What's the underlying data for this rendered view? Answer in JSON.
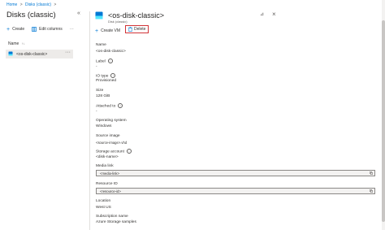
{
  "breadcrumb": {
    "items": [
      "Home",
      "Disks (classic)"
    ],
    "separator": ">"
  },
  "left_pane": {
    "title": "Disks (classic)",
    "collapse_glyph": "«",
    "toolbar": {
      "create": "Create",
      "edit_columns": "Edit columns",
      "more": "···"
    },
    "column_header": "Name",
    "sort_glyph": "↑↓",
    "items": [
      {
        "label": "<os-disk-classic>",
        "more": "···"
      }
    ]
  },
  "right_pane": {
    "title": "<os-disk-classic>",
    "subtitle": "Disk (classic)",
    "pin_glyph": "⊿",
    "close_glyph": "×",
    "toolbar": {
      "create_vm": "Create VM",
      "delete": "Delete"
    },
    "fields": {
      "name": {
        "label": "Name",
        "value": "<os-disk-classic>"
      },
      "label": {
        "label": "Label",
        "value": "-"
      },
      "io_type": {
        "label": "IO type",
        "value": "Provisioned"
      },
      "size": {
        "label": "Size",
        "value": "128 GiB"
      },
      "attached_to": {
        "label": "Attached to",
        "value": "-"
      },
      "os": {
        "label": "Operating system",
        "value": "Windows"
      },
      "source_image": {
        "label": "Source image",
        "value": "<source-image>.vhd"
      },
      "storage_account": {
        "label": "Storage account",
        "value": "<disk-name>"
      },
      "media_link": {
        "label": "Media link",
        "value": "<media-link>"
      },
      "resource_id": {
        "label": "Resource ID",
        "value": "<resource-id>"
      },
      "location": {
        "label": "Location",
        "value": "West US"
      },
      "subscription": {
        "label": "Subscription name",
        "value": "Azure Storage samples"
      }
    }
  },
  "icons": [
    "disk-icon",
    "plus-icon",
    "edit-columns-icon",
    "pin-icon",
    "close-icon",
    "trash-icon",
    "info-icon",
    "copy-icon"
  ],
  "colors": {
    "accent": "#0078d4",
    "delete_highlight": "#d13438",
    "selected_row": "#edebe9"
  }
}
